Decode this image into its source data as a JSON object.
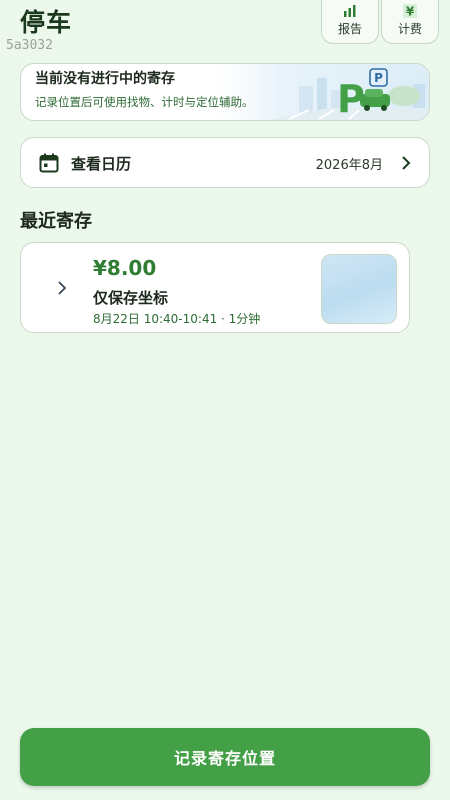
{
  "header": {
    "title": "停车",
    "debug_id": "5a3032",
    "report_label": "报告",
    "fee_label": "计费",
    "fee_icon": "¥"
  },
  "status": {
    "title": "当前没有进行中的寄存",
    "subtitle": "记录位置后可使用找物、计时与定位辅助。",
    "sign_small": "P",
    "sign_big": "P"
  },
  "calendar": {
    "label": "查看日历",
    "value": "2026年8月"
  },
  "recent": {
    "title": "最近寄存",
    "items": [
      {
        "price": "¥8.00",
        "type": "仅保存坐标",
        "time": "8月22日 10:40-10:41 · 1分钟"
      }
    ]
  },
  "actions": {
    "primary_label": "记录寄存位置"
  },
  "colors": {
    "accent": "#43a047",
    "accent_dark": "#2e7d32",
    "background": "#ecf8ec"
  }
}
